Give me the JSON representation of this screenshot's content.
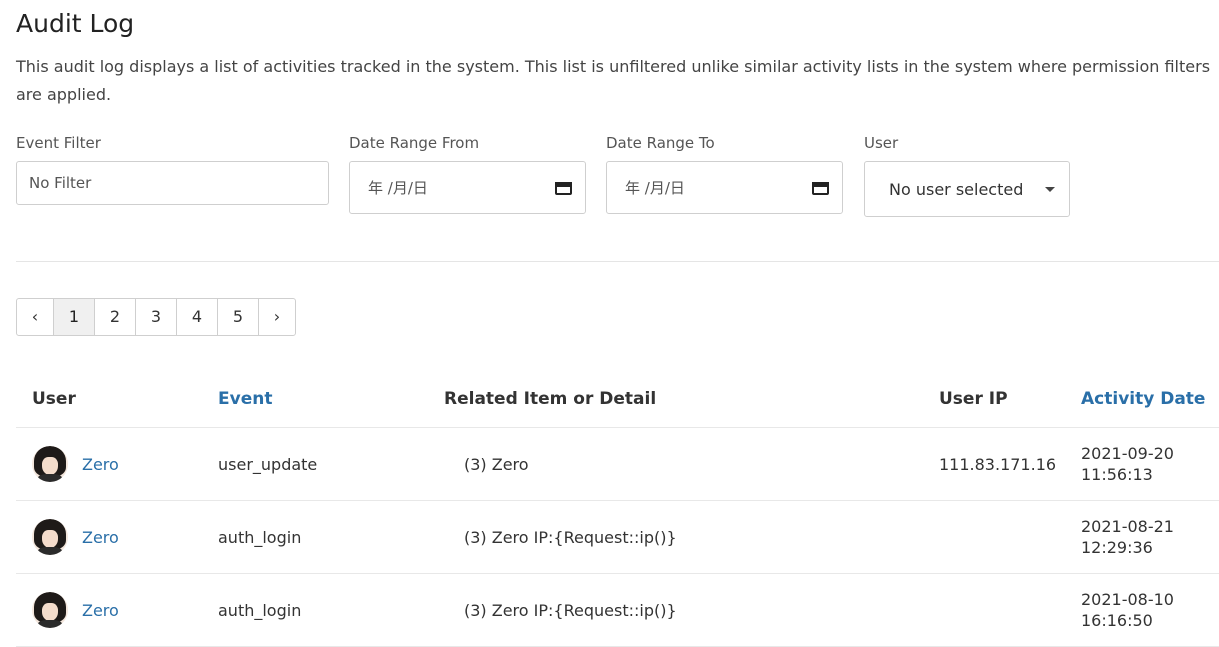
{
  "page": {
    "title": "Audit Log",
    "description": "This audit log displays a list of activities tracked in the system. This list is unfiltered unlike similar activity lists in the system where permission filters are applied."
  },
  "filters": {
    "event": {
      "label": "Event Filter",
      "value": "No Filter"
    },
    "date_from": {
      "label": "Date Range From",
      "value": "年 /月/日",
      "icon": "calendar-icon"
    },
    "date_to": {
      "label": "Date Range To",
      "value": "年 /月/日",
      "icon": "calendar-icon"
    },
    "user": {
      "label": "User",
      "value": "No user selected",
      "icon": "caret-down-icon"
    }
  },
  "pagination": {
    "prev": "‹",
    "pages": [
      "1",
      "2",
      "3",
      "4",
      "5"
    ],
    "current_page": "1",
    "next": "›"
  },
  "table": {
    "headers": {
      "user": "User",
      "event": "Event",
      "detail": "Related Item or Detail",
      "ip": "User IP",
      "date": "Activity Date"
    },
    "rows": [
      {
        "user": "Zero",
        "event": "user_update",
        "detail": "(3) Zero",
        "ip": "111.83.171.16",
        "date": "2021-09-20",
        "time": "11:56:13"
      },
      {
        "user": "Zero",
        "event": "auth_login",
        "detail": "(3) Zero IP:{Request::ip()}",
        "ip": "",
        "date": "2021-08-21",
        "time": "12:29:36"
      },
      {
        "user": "Zero",
        "event": "auth_login",
        "detail": "(3) Zero IP:{Request::ip()}",
        "ip": "",
        "date": "2021-08-10",
        "time": "16:16:50"
      }
    ]
  },
  "colors": {
    "link": "#2a6fa8",
    "border": "#cfcfcf",
    "active_page_bg": "#f0f0f0"
  }
}
